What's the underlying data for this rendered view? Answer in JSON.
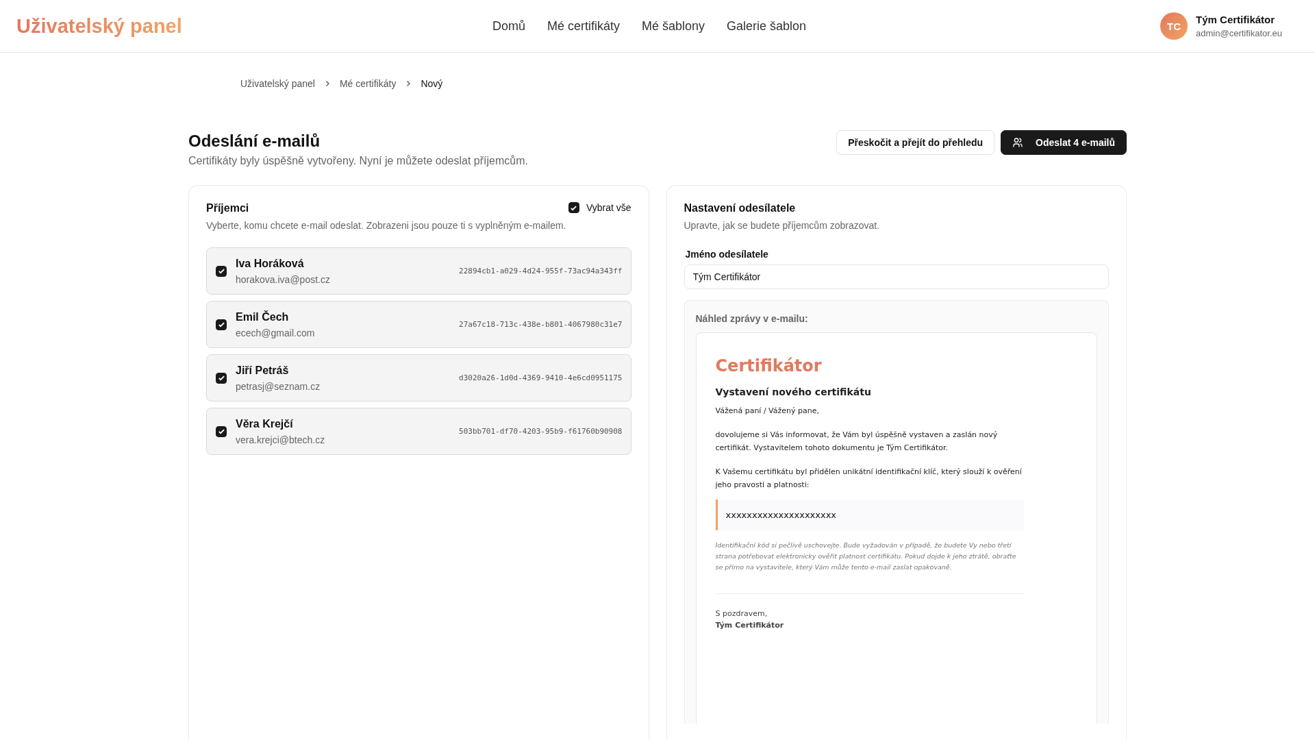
{
  "header": {
    "logo": "Uživatelský panel",
    "nav": [
      "Domů",
      "Mé certifikáty",
      "Mé šablony",
      "Galerie šablon"
    ],
    "user": {
      "initials": "TC",
      "name": "Tým Certifikátor",
      "email": "admin@certifikator.eu"
    }
  },
  "breadcrumb": [
    "Uživatelský panel",
    "Mé certifikáty",
    "Nový"
  ],
  "page": {
    "title": "Odeslání e-mailů",
    "subtitle": "Certifikáty byly úspěšně vytvořeny. Nyní je můžete odeslat příjemcům.",
    "skip_button": "Přeskočit a přejít do přehledu",
    "send_button": "Odeslat 4 e-mailů"
  },
  "recipients": {
    "title": "Příjemci",
    "select_all": {
      "label": "Vybrat vše",
      "checked": true
    },
    "description": "Vyberte, komu chcete e-mail odeslat. Zobrazeni jsou pouze ti s vyplněným e-mailem.",
    "items": [
      {
        "name": "Iva Horáková",
        "email": "horakova.iva@post.cz",
        "id": "22894cb1-a029-4d24-955f-73ac94a343ff",
        "checked": true
      },
      {
        "name": "Emil Čech",
        "email": "ecech@gmail.com",
        "id": "27a67c18-713c-438e-b801-4067980c31e7",
        "checked": true
      },
      {
        "name": "Jiří Petráš",
        "email": "petrasj@seznam.cz",
        "id": "d3020a26-1d0d-4369-9410-4e6cd0951175",
        "checked": true
      },
      {
        "name": "Věra Krejčí",
        "email": "vera.krejci@btech.cz",
        "id": "503bb701-df70-4203-95b9-f61760b90908",
        "checked": true
      }
    ]
  },
  "sender": {
    "title": "Nastavení odesílatele",
    "description": "Upravte, jak se budete příjemcům zobrazovat.",
    "field_label": "Jméno odesílatele",
    "field_value": "Tým Certifikátor",
    "preview_label": "Náhled zprávy v e-mailu:",
    "email": {
      "brand": "Certifikátor",
      "heading": "Vystavení nového certifikátu",
      "greeting": "Vážená paní / Vážený pane,",
      "paragraphs": [
        "dovolujeme si Vás informovat, že Vám byl úspěšně vystaven a zaslán nový certifikát. Vystavitelem tohoto dokumentu je Tým Certifikátor.",
        "K Vašemu certifikátu byl přidělen unikátní identifikační klíč, který slouží k ověření jeho pravosti a platnosti:"
      ],
      "code": "xxxxxxxxxxxxxxxxxxxxx",
      "note": "Identifikační kód si pečlivě uschovejte. Bude vyžadován v případě, že budete Vy nebo třetí strana potřebovat elektronicky ověřit platnost certifikátu. Pokud dojde k jeho ztrátě, obraťte se přímo na vystavitele, který Vám může tento e-mail zaslat opakovaně.",
      "closing": "S pozdravem,",
      "signature": "Tým Certifikátor"
    }
  }
}
